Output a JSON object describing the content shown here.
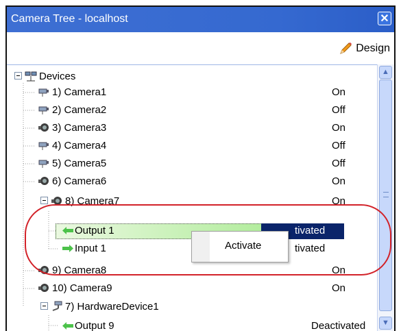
{
  "window": {
    "title": "Camera Tree - localhost",
    "close_glyph": "✕"
  },
  "toolbar": {
    "design_label": "Design",
    "design_icon": "pencil-icon"
  },
  "tree": {
    "root": {
      "label": "Devices",
      "expander": "minus"
    },
    "rows": [
      {
        "label": "1) Camera1",
        "status": "On",
        "icon": "camera-box-icon"
      },
      {
        "label": "2) Camera2",
        "status": "Off",
        "icon": "camera-box-icon"
      },
      {
        "label": "3) Camera3",
        "status": "On",
        "icon": "dome-camera-icon"
      },
      {
        "label": "4) Camera4",
        "status": "Off",
        "icon": "camera-box-icon"
      },
      {
        "label": "5) Camera5",
        "status": "Off",
        "icon": "camera-box-icon"
      },
      {
        "label": "6) Camera6",
        "status": "On",
        "icon": "dome-camera-icon"
      },
      {
        "label": "8) Camera7",
        "status": "On",
        "icon": "dome-camera-icon",
        "expander": "minus"
      },
      {
        "label": "Output 1",
        "status": "tivated",
        "icon": "green-arrow-left-icon",
        "selected": true
      },
      {
        "label": "Input 1",
        "status": "tivated",
        "icon": "green-arrow-right-icon"
      },
      {
        "label": "9) Camera8",
        "status": "On",
        "icon": "dome-camera-icon"
      },
      {
        "label": "10) Camera9",
        "status": "On",
        "icon": "dome-camera-icon"
      },
      {
        "label": "7) HardwareDevice1",
        "status": "",
        "icon": "ptz-camera-icon",
        "expander": "minus"
      },
      {
        "label": "Output 9",
        "status": "Deactivated",
        "icon": "green-arrow-left-icon"
      }
    ]
  },
  "context_menu": {
    "items": [
      {
        "label": "Activate"
      }
    ]
  }
}
